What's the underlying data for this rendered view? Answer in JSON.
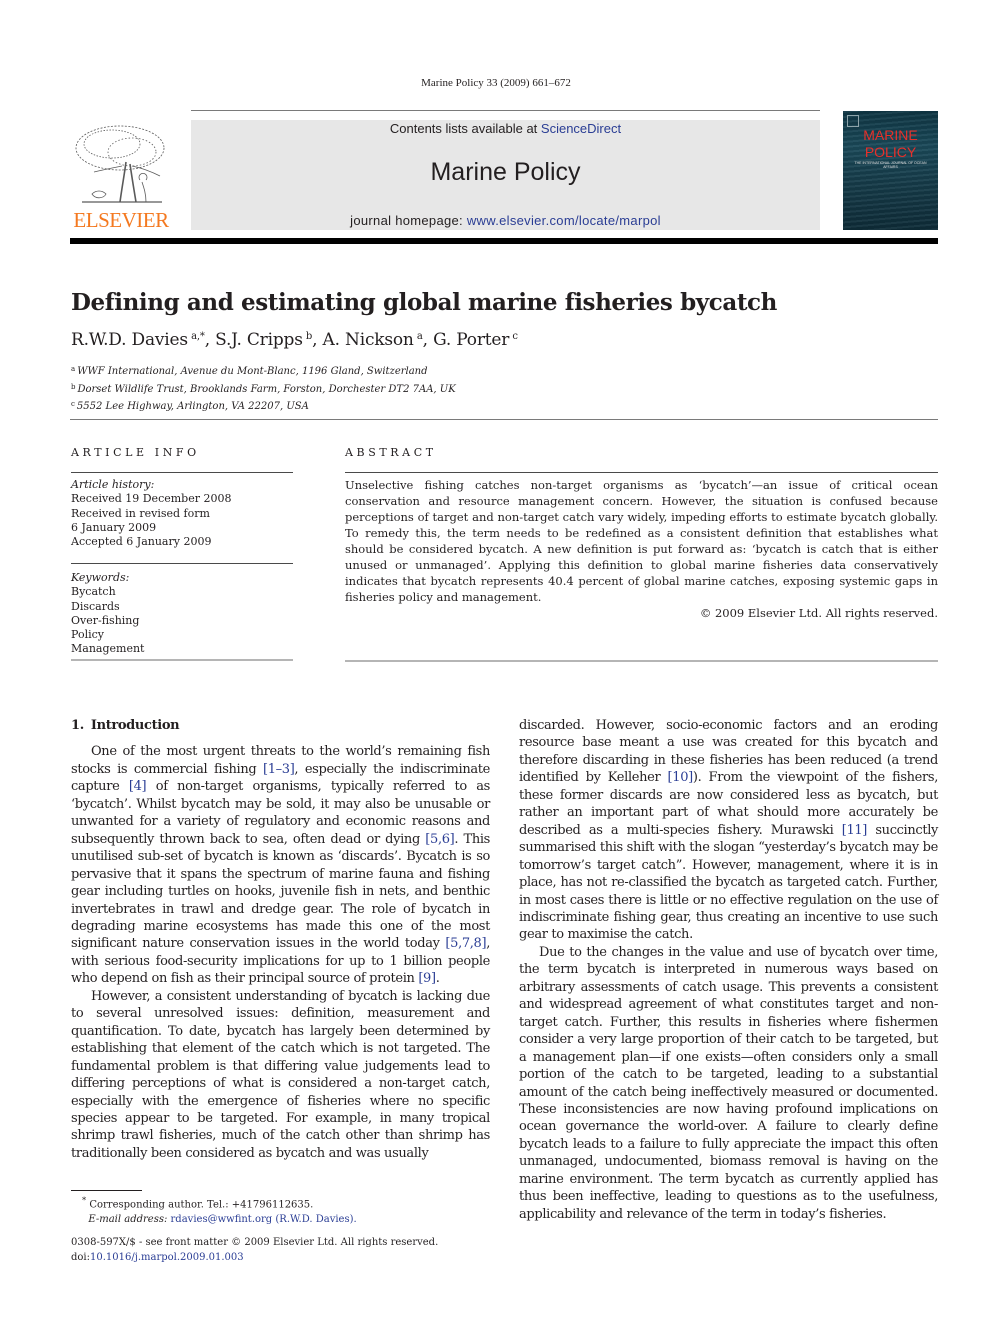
{
  "running_head": "Marine Policy 33 (2009) 661–672",
  "masthead": {
    "contents_prefix": "Contents lists available at ",
    "contents_link": "ScienceDirect",
    "journal_name": "Marine Policy",
    "homepage_prefix": "journal homepage: ",
    "homepage_link": "www.elsevier.com/locate/marpol",
    "publisher_logo_text": "ELSEVIER",
    "cover_title_line1": "MARINE",
    "cover_title_line2": "POLICY",
    "cover_subtitle": "THE INTERNATIONAL JOURNAL OF OCEAN AFFAIRS"
  },
  "colors": {
    "elsevier_orange": "#f47920",
    "link_blue": "#2a3d94",
    "cover_red": "#e8302a",
    "masthead_gray": "#e7e7e7"
  },
  "article": {
    "title": "Defining and estimating global marine fisheries bycatch",
    "authors": [
      {
        "name": "R.W.D. Davies",
        "sup": "a,*",
        "sep": ", "
      },
      {
        "name": "S.J. Cripps",
        "sup": "b",
        "sep": ", "
      },
      {
        "name": "A. Nickson",
        "sup": "a",
        "sep": ", "
      },
      {
        "name": "G. Porter",
        "sup": "c",
        "sep": ""
      }
    ],
    "affiliations": [
      {
        "sup": "a",
        "text": "WWF International, Avenue du Mont-Blanc, 1196 Gland, Switzerland"
      },
      {
        "sup": "b",
        "text": "Dorset Wildlife Trust, Brooklands Farm, Forston, Dorchester DT2 7AA, UK"
      },
      {
        "sup": "c",
        "text": "5552 Lee Highway, Arlington, VA 22207, USA"
      }
    ]
  },
  "article_info": {
    "heading": "ARTICLE INFO",
    "history_label": "Article history:",
    "history": [
      "Received 19 December 2008",
      "Received in revised form",
      "6 January 2009",
      "Accepted 6 January 2009"
    ],
    "keywords_label": "Keywords:",
    "keywords": [
      "Bycatch",
      "Discards",
      "Over-fishing",
      "Policy",
      "Management"
    ]
  },
  "abstract": {
    "heading": "ABSTRACT",
    "text": "Unselective fishing catches non-target organisms as ‘bycatch’—an issue of critical ocean conservation and resource management concern. However, the situation is confused because perceptions of target and non-target catch vary widely, impeding efforts to estimate bycatch globally. To remedy this, the term needs to be redefined as a consistent definition that establishes what should be considered bycatch. A new definition is put forward as: ‘bycatch is catch that is either unused or unmanaged’. Applying this definition to global marine fisheries data conservatively indicates that bycatch represents 40.4 percent of global marine catches, exposing systemic gaps in fisheries policy and management.",
    "copyright": "© 2009 Elsevier Ltd. All rights reserved."
  },
  "body": {
    "section_number": "1.",
    "section_title": "Introduction",
    "left_p1": [
      {
        "t": "One of the most urgent threats to the world’s remaining fish stocks is commercial fishing "
      },
      {
        "r": "[1–3]"
      },
      {
        "t": ", especially the indiscriminate capture "
      },
      {
        "r": "[4]"
      },
      {
        "t": " of non-target organisms, typically referred to as ‘bycatch’. Whilst bycatch may be sold, it may also be unusable or unwanted for a variety of regulatory and economic reasons and subsequently thrown back to sea, often dead or dying "
      },
      {
        "r": "[5,6]"
      },
      {
        "t": ". This unutilised sub-set of bycatch is known as ‘discards’. Bycatch is so pervasive that it spans the spectrum of marine fauna and fishing gear including turtles on hooks, juvenile fish in nets, and benthic invertebrates in trawl and dredge gear. The role of bycatch in degrading marine ecosystems has made this one of the most significant nature conservation issues in the world today "
      },
      {
        "r": "[5,7,8]"
      },
      {
        "t": ", with serious food-security implications for up to 1 billion people who depend on fish as their principal source of protein "
      },
      {
        "r": "[9]"
      },
      {
        "t": "."
      }
    ],
    "left_p2": "However, a consistent understanding of bycatch is lacking due to several unresolved issues: definition, measurement and quantification. To date, bycatch has largely been determined by establishing that element of the catch which is not targeted. The fundamental problem is that differing value judgements lead to differing perceptions of what is considered a non-target catch, especially with the emergence of fisheries where no specific species appear to be targeted. For example, in many tropical shrimp trawl fisheries, much of the catch other than shrimp has traditionally been considered as bycatch and was usually",
    "right_p1": [
      {
        "t": "discarded. However, socio-economic factors and an eroding resource base meant a use was created for this bycatch and therefore discarding in these fisheries has been reduced (a trend identified by Kelleher "
      },
      {
        "r": "[10]"
      },
      {
        "t": "). From the viewpoint of the fishers, these former discards are now considered less as bycatch, but rather an important part of what should more accurately be described as a multi-species fishery. Murawski "
      },
      {
        "r": "[11]"
      },
      {
        "t": " succinctly summarised this shift with the slogan “yesterday’s bycatch may be tomorrow’s target catch”. However, management, where it is in place, has not re-classified the bycatch as targeted catch. Further, in most cases there is little or no effective regulation on the use of indiscriminate fishing gear, thus creating an incentive to use such gear to maximise the catch."
      }
    ],
    "right_p2": "Due to the changes in the value and use of bycatch over time, the term bycatch is interpreted in numerous ways based on arbitrary assessments of catch usage. This prevents a consistent and widespread agreement of what constitutes target and non-target catch. Further, this results in fisheries where fishermen consider a very large proportion of their catch to be targeted, but a management plan—if one exists—often considers only a small portion of the catch to be targeted, leading to a substantial amount of the catch being ineffectively measured or documented. These inconsistencies are now having profound implications on ocean governance the world-over. A failure to clearly define bycatch leads to a failure to fully appreciate the impact this often unmanaged, undocumented, biomass removal is having on the marine environment. The term bycatch as currently applied has thus been ineffective, leading to questions as to the usefulness, applicability and relevance of the term in today’s fisheries."
  },
  "footnote": {
    "marker": "*",
    "corresponding": "Corresponding author. Tel.: +41796112635.",
    "email_label": "E-mail address:",
    "email": "rdavies@wwfint.org",
    "email_name": "(R.W.D. Davies)."
  },
  "front_matter": {
    "line1": "0308-597X/$ - see front matter © 2009 Elsevier Ltd. All rights reserved.",
    "doi_label": "doi:",
    "doi": "10.1016/j.marpol.2009.01.003"
  }
}
